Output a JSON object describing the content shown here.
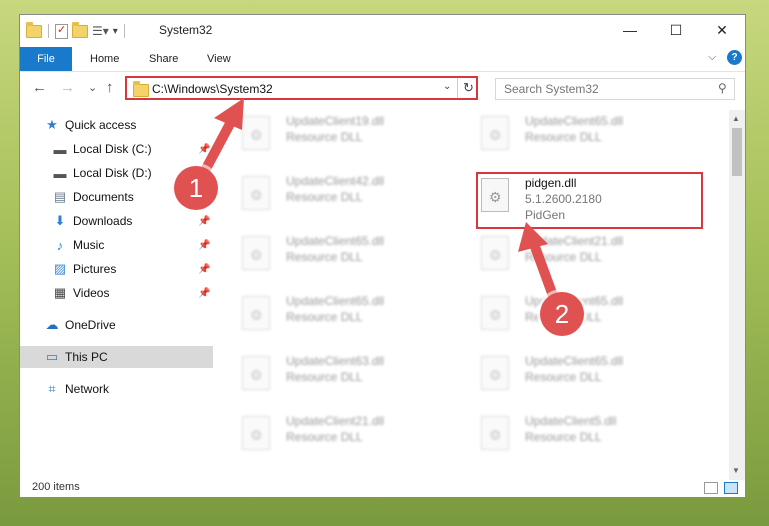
{
  "window": {
    "title": "System32",
    "controls": {
      "minimize": "—",
      "maximize": "☐",
      "close": "✕"
    }
  },
  "ribbon": {
    "file": "File",
    "tabs": [
      "Home",
      "Share",
      "View"
    ],
    "expand": "⌵",
    "help": "?"
  },
  "nav": {
    "back": "←",
    "forward": "→",
    "recent": "⌄",
    "up": "↑",
    "address": "C:\\Windows\\System32",
    "dropdown": "⌄",
    "refresh": "↻",
    "search_placeholder": "Search System32",
    "search_icon": "⚲"
  },
  "sidebar": {
    "items": [
      {
        "label": "Quick access",
        "icon": "★",
        "pinned": false
      },
      {
        "label": "Local Disk (C:)",
        "icon": "▬",
        "pinned": true
      },
      {
        "label": "Local Disk (D:)",
        "icon": "▬",
        "pinned": true
      },
      {
        "label": "Documents",
        "icon": "▤",
        "pinned": true
      },
      {
        "label": "Downloads",
        "icon": "⬇",
        "pinned": true
      },
      {
        "label": "Music",
        "icon": "♪",
        "pinned": true
      },
      {
        "label": "Pictures",
        "icon": "▨",
        "pinned": true
      },
      {
        "label": "Videos",
        "icon": "▦",
        "pinned": true
      },
      {
        "label": "OneDrive",
        "icon": "☁",
        "pinned": false
      },
      {
        "label": "This PC",
        "icon": "▭",
        "pinned": false
      },
      {
        "label": "Network",
        "icon": "⌗",
        "pinned": false
      }
    ],
    "pin_glyph": "📌"
  },
  "files": {
    "left": [
      {
        "name": "UpdateClient19.dll",
        "ver": "Resource DLL"
      },
      {
        "name": "UpdateClient42.dll",
        "ver": "Resource DLL"
      },
      {
        "name": "UpdateClient65.dll",
        "ver": "Resource DLL"
      },
      {
        "name": "UpdateClient65.dll",
        "ver": "Resource DLL"
      },
      {
        "name": "UpdateClient63.dll",
        "ver": "Resource DLL"
      },
      {
        "name": "UpdateClient21.dll",
        "ver": "Resource DLL"
      }
    ],
    "right": [
      {
        "name": "UpdateClient65.dll",
        "ver": "Resource DLL"
      },
      {
        "name": "pidgen.dll",
        "ver": "5.1.2600.2180",
        "desc": "PidGen"
      },
      {
        "name": "UpdateClient21.dll",
        "ver": "Resource DLL"
      },
      {
        "name": "UpdateClient65.dll",
        "ver": "Resource DLL"
      },
      {
        "name": "UpdateClient65.dll",
        "ver": "Resource DLL"
      },
      {
        "name": "UpdateClient5.dll",
        "ver": "Resource DLL"
      }
    ]
  },
  "status": {
    "count": "200 items"
  },
  "callouts": {
    "one": "1",
    "two": "2"
  },
  "colors": {
    "accent": "#1979ca",
    "highlight": "#d9363e",
    "callout": "#e05252"
  }
}
